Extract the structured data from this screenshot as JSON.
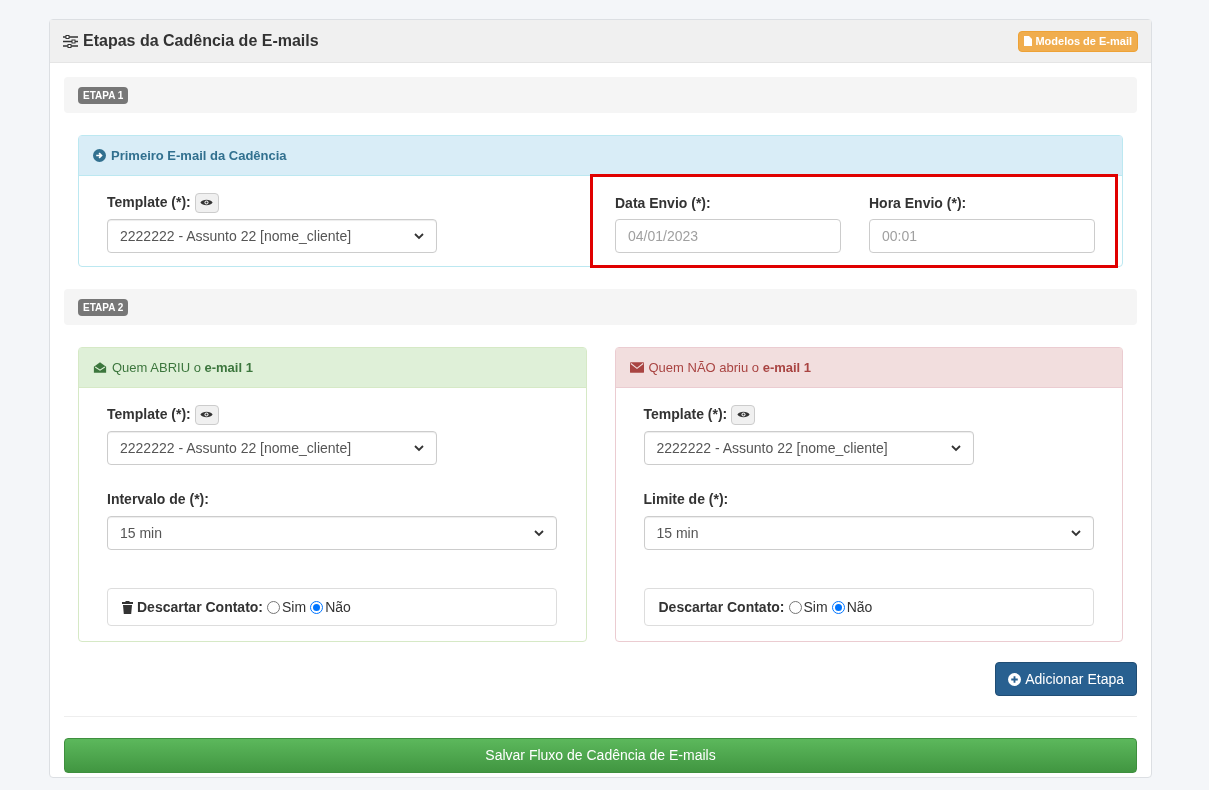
{
  "header": {
    "title": "Etapas da Cadência de E-mails",
    "models_button": "Modelos de E-mail"
  },
  "stages": [
    {
      "badge": "ETAPA 1",
      "panels": [
        {
          "kind": "info",
          "title": "Primeiro E-mail da Cadência",
          "template": {
            "label": "Template (*):",
            "value": "2222222 - Assunto 22 [nome_cliente]"
          },
          "highlighted": true,
          "dates": [
            {
              "label": "Data Envio (*):",
              "placeholder": "04/01/2023"
            },
            {
              "label": "Hora Envio (*):",
              "placeholder": "00:01"
            }
          ]
        }
      ]
    },
    {
      "badge": "ETAPA 2",
      "panels": [
        {
          "kind": "success",
          "title": "Quem ABRIU o **e-mail 1**",
          "template": {
            "label": "Template (*):",
            "value": "2222222 - Assunto 22 [nome_cliente]"
          },
          "interval": {
            "label": "Intervalo de (*):",
            "value": "15 min"
          },
          "discard": {
            "label": "Descartar Contato:",
            "trash_icon": true,
            "options": [
              {
                "label": "Sim",
                "selected": false
              },
              {
                "label": "Não",
                "selected": true
              }
            ]
          }
        },
        {
          "kind": "danger",
          "title": "Quem NÃO abriu o **e-mail 1**",
          "template": {
            "label": "Template (*):",
            "value": "2222222 - Assunto 22 [nome_cliente]"
          },
          "interval": {
            "label": "Limite de (*):",
            "value": "15 min"
          },
          "discard": {
            "label": "Descartar Contato:",
            "trash_icon": false,
            "options": [
              {
                "label": "Sim",
                "selected": false
              },
              {
                "label": "Não",
                "selected": true
              }
            ]
          }
        }
      ]
    }
  ],
  "add_button": "Adicionar Etapa",
  "save_button": "Salvar Fluxo de Cadência de E-mails"
}
